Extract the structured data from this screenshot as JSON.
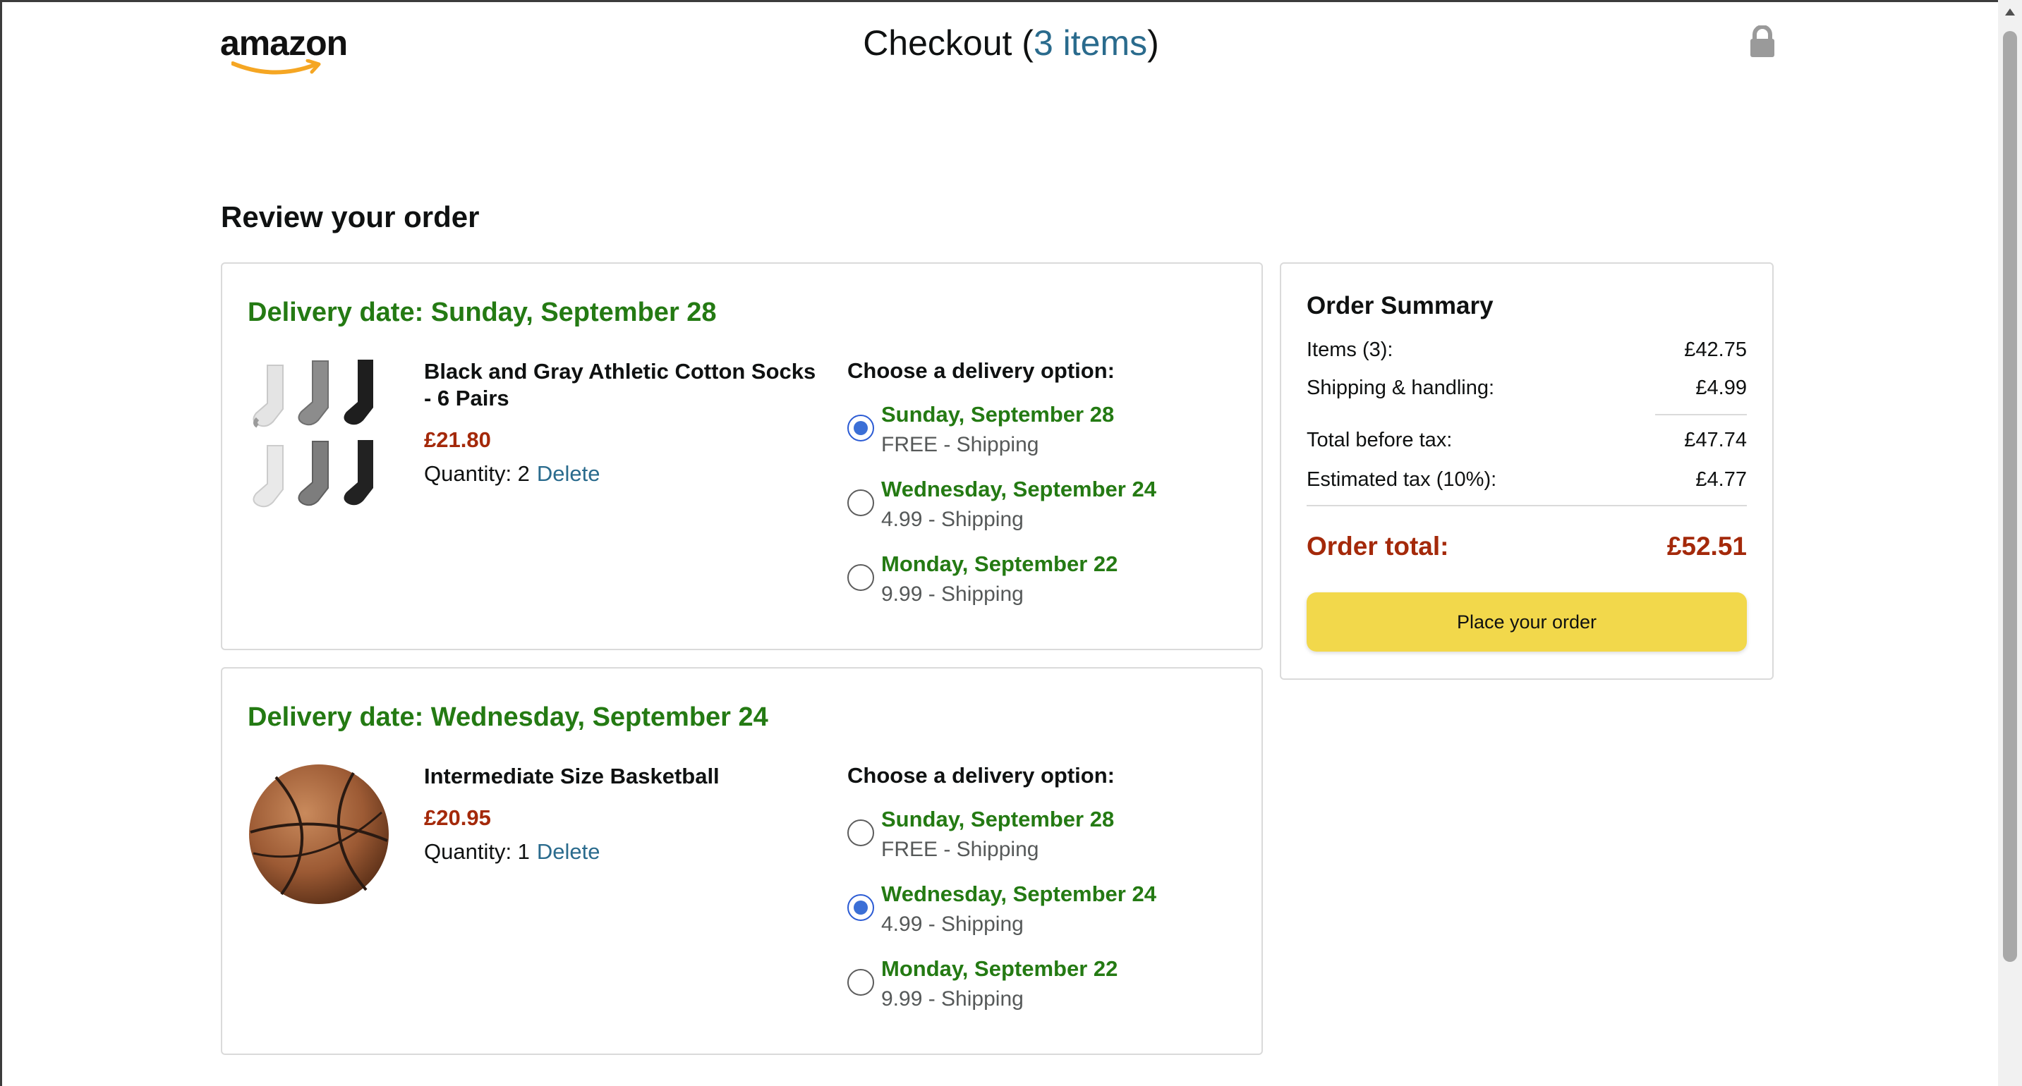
{
  "header": {
    "logo_text": "amazon",
    "checkout_prefix": "Checkout (",
    "items_link": "3 items",
    "checkout_suffix": ")"
  },
  "review_title": "Review your order",
  "orders": [
    {
      "delivery_date": "Delivery date: Sunday, September 28",
      "product_name": "Black and Gray Athletic Cotton Socks - 6 Pairs",
      "price": "£21.80",
      "quantity": "Quantity: 2",
      "delete_label": "Delete",
      "options_heading": "Choose a delivery option:",
      "options": [
        {
          "date": "Sunday, September 28",
          "shipping": "FREE - Shipping",
          "selected": true
        },
        {
          "date": "Wednesday, September 24",
          "shipping": "4.99 - Shipping",
          "selected": false
        },
        {
          "date": "Monday, September 22",
          "shipping": "9.99 - Shipping",
          "selected": false
        }
      ]
    },
    {
      "delivery_date": "Delivery date: Wednesday, September 24",
      "product_name": "Intermediate Size Basketball",
      "price": "£20.95",
      "quantity": "Quantity: 1",
      "delete_label": "Delete",
      "options_heading": "Choose a delivery option:",
      "options": [
        {
          "date": "Sunday, September 28",
          "shipping": "FREE - Shipping",
          "selected": false
        },
        {
          "date": "Wednesday, September 24",
          "shipping": "4.99 - Shipping",
          "selected": true
        },
        {
          "date": "Monday, September 22",
          "shipping": "9.99 - Shipping",
          "selected": false
        }
      ]
    }
  ],
  "summary": {
    "title": "Order Summary",
    "items_label": "Items (3):",
    "items_value": "£42.75",
    "shipping_label": "Shipping & handling:",
    "shipping_value": "£4.99",
    "before_tax_label": "Total before tax:",
    "before_tax_value": "£47.74",
    "tax_label": "Estimated tax (10%):",
    "tax_value": "£4.77",
    "total_label": "Order total:",
    "total_value": "£52.51",
    "place_order_label": "Place your order"
  },
  "colors": {
    "delivery_green": "#247a13",
    "price_red": "#a4290a",
    "link_blue": "#2a6b8d",
    "button_yellow": "#f2d84b",
    "radio_blue": "#3b6fd6"
  },
  "icons": [
    "amazon-logo",
    "lock-icon",
    "socks-image",
    "basketball-image",
    "radio-button"
  ]
}
